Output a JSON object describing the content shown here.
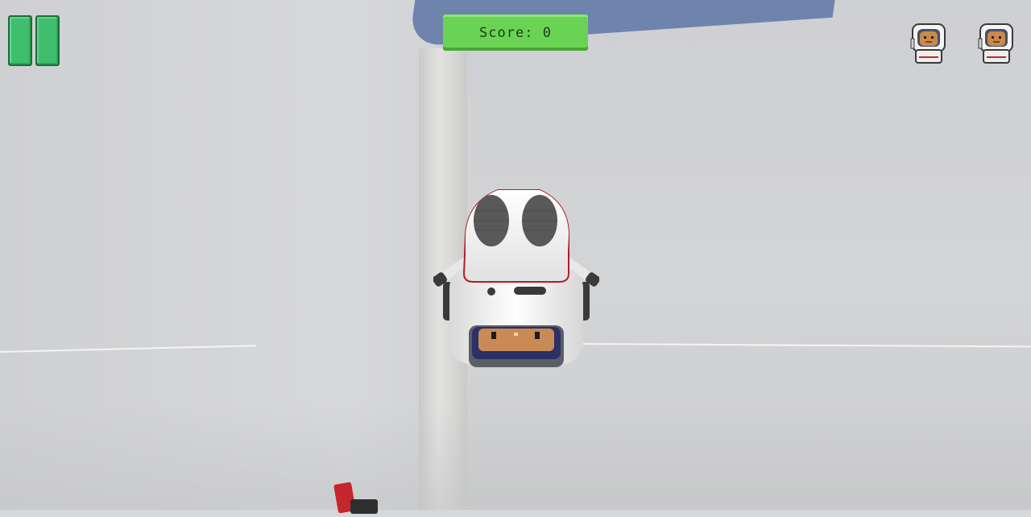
{
  "hud": {
    "score_label": "Score: 0",
    "pause_icon": "pause-icon",
    "lives": [
      {
        "icon": "astronaut-icon"
      },
      {
        "icon": "astronaut-icon"
      }
    ]
  },
  "colors": {
    "score_bg": "#6bd353",
    "pause_green": "#3fbf6e",
    "sky": "#6e84ad",
    "robot_body": "#f2f2f2",
    "robot_accent": "#c0262b"
  }
}
